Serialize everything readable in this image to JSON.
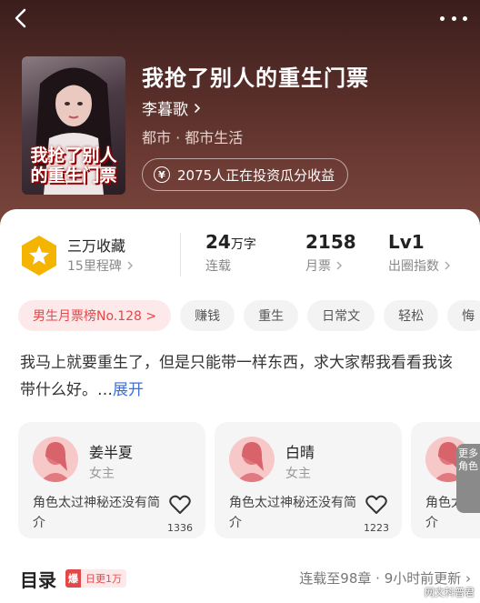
{
  "nav": {
    "back_icon": "chevron-left-icon",
    "more_icon": "more-dots-icon"
  },
  "book": {
    "title": "我抢了别人的重生门票",
    "cover_text": "我抢了别人的重生门票",
    "author": "李暮歌",
    "genre": "都市 · 都市生活",
    "invest_text": "2075人正在投资瓜分收益"
  },
  "stats": {
    "collect_main": "三万收藏",
    "collect_sub": "15里程碑",
    "words_value": "24",
    "words_unit": "万字",
    "words_label": "连载",
    "tickets_value": "2158",
    "tickets_label": "月票",
    "level_value": "Lv1",
    "level_label": "出圈指数"
  },
  "tags": [
    "男生月票榜No.128 >",
    "赚钱",
    "重生",
    "日常文",
    "轻松",
    "悔"
  ],
  "synopsis": {
    "text": "我马上就要重生了，但是只能带一样东西，求大家帮我看看我该带什么好。…",
    "expand": "展开"
  },
  "roles": [
    {
      "name": "姜半夏",
      "type": "女主",
      "desc": "角色太过神秘还没有简介",
      "likes": "1336"
    },
    {
      "name": "白晴",
      "type": "女主",
      "desc": "角色太过神秘还没有简介",
      "likes": "1223"
    },
    {
      "name": "",
      "type": "",
      "desc": "角色太过神秘还没有简介",
      "likes": ""
    }
  ],
  "more_roles": "更多角色",
  "toc": {
    "title": "目录",
    "badge_icon": "爆",
    "badge_text": "日更1万",
    "status": "连载至98章 · 9小时前更新 ›"
  },
  "watermark": "网文科普君",
  "colors": {
    "accent": "#e2484a",
    "link": "#3d6fd6",
    "gold": "#f5b400",
    "hero_bg": "#5a2f2a"
  }
}
